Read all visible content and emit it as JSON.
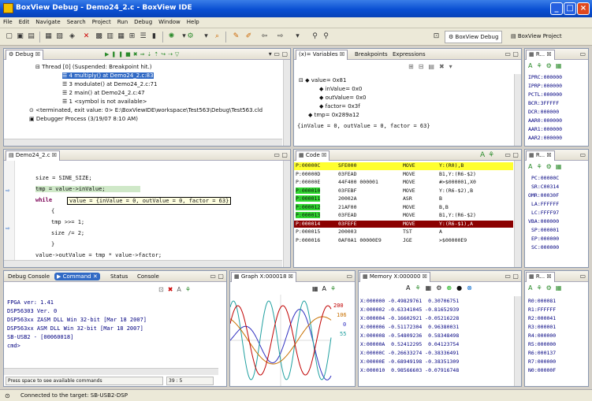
{
  "window": {
    "title": "BoxView Debug - Demo24_2.c - BoxView IDE",
    "min": "_",
    "max": "□",
    "close": "×"
  },
  "menu": [
    "File",
    "Edit",
    "Navigate",
    "Search",
    "Project",
    "Run",
    "Debug",
    "Window",
    "Help"
  ],
  "perspectives": {
    "debug": "BoxView Debug",
    "project": "BoxView Project"
  },
  "debug_view": {
    "tab": "Debug",
    "rows": [
      "Thread [0] (Suspended: Breakpoint hit.)",
      "4 multiply() at Demo24_2.c:83",
      "3 modulate() at Demo24_2.c:71",
      "2 main() at Demo24_2.c:47",
      "1 <symbol is not available>",
      "<terminated, exit value: 0> E:\\BoxViewIDE\\workspace\\Test563\\Debug\\Test563.cld",
      "Debugger Process (3/19/07 8:10 AM)"
    ]
  },
  "variables_view": {
    "tabs": [
      "Variables",
      "Breakpoints",
      "Expressions"
    ],
    "rows": [
      "value= 0x81",
      "inValue= 0x0",
      "outValue= 0x0",
      "factor= 0x3f",
      "tmp= 0x289a12"
    ],
    "detail": "{inValue = 0, outValue = 0, factor = 63}"
  },
  "reg_top": {
    "tab": "R...",
    "rows": [
      "IPRC:000000",
      "IPRP:000000",
      "PCTL:000000",
      "BCR:3FFFFF",
      "DCR:000000",
      "AAR0:000000",
      "AAR1:000000",
      "AAR2:000000"
    ]
  },
  "editor": {
    "tab": "Demo24_2.c",
    "lines": [
      "size = SINE_SIZE;",
      "tmp = value->inValue;",
      "while (value = {inValue = 0, outValue = 0, factor = 63}",
      "{",
      "tmp >>= 1;",
      "size /= 2;",
      "}",
      "value->outValue = tmp * value->factor;"
    ],
    "hover": "value = {inValue = 0, outValue = 0, factor = 63}"
  },
  "code_view": {
    "tab": "Code",
    "rows": [
      {
        "addr": "P:00000C",
        "op": "SFE000",
        "mn": "MOVE",
        "arg": "Y:(R0),B",
        "hl": "yellow"
      },
      {
        "addr": "P:00000D",
        "op": "03FEAD",
        "mn": "MOVE",
        "arg": "B1,Y:(R6-$2)",
        "hl": ""
      },
      {
        "addr": "P:00000E",
        "op": "44F400 000001",
        "mn": "MOVE",
        "arg": "#>$000001,X0",
        "hl": ""
      },
      {
        "addr": "P:000010",
        "op": "03FEBF",
        "mn": "MOVE",
        "arg": "Y:(R6-$2),B",
        "hl": "green"
      },
      {
        "addr": "P:000011",
        "op": "20002A",
        "mn": "ASR",
        "arg": "B",
        "hl": "green"
      },
      {
        "addr": "P:000012",
        "op": "21AF00",
        "mn": "MOVE",
        "arg": "B,B",
        "hl": "green"
      },
      {
        "addr": "P:000013",
        "op": "03FEAD",
        "mn": "MOVE",
        "arg": "B1,Y:(R6-$2)",
        "hl": "green"
      },
      {
        "addr": "P:000014",
        "op": "03FEFE",
        "mn": "MOVE",
        "arg": "Y:(R6-$1),A",
        "hl": "red"
      },
      {
        "addr": "P:000015",
        "op": "200003",
        "mn": "TST",
        "arg": "A",
        "hl": ""
      },
      {
        "addr": "P:000016",
        "op": "0AF0A1 00000E9",
        "mn": "JGE",
        "arg": ">$00000E9",
        "hl": ""
      }
    ]
  },
  "reg_mid": {
    "tab": "R...",
    "rows": [
      "PC:00000C",
      "SR:C00314",
      "OMR:00030F",
      "LA:FFFFFF",
      "LC:FFFF97",
      "VBA:000000",
      "SP:000001",
      "EP:000000",
      "SC:000000"
    ]
  },
  "console": {
    "tabs": [
      "Debug Console",
      "Command",
      "Status",
      "Console"
    ],
    "lines": [
      "FPGA ver: 1.41",
      "DSP56303 Ver. 0",
      "DSP563xx ZASM DLL Win 32-bit [Mar 18 2007]",
      "DSP563xx ASM DLL Win 32-bit [Mar 18 2007]",
      "SB-USB2 - [00060018]",
      "cmd>"
    ],
    "hint": "Press space to see available commands",
    "pos": "39 : 5"
  },
  "graph": {
    "tab": "Graph X:000018",
    "labels": [
      "200",
      "106",
      "0",
      "55"
    ],
    "colors": [
      "#c00000",
      "#c87000",
      "#3030c0",
      "#20a0a0"
    ]
  },
  "memory": {
    "tab": "Memory X:000000",
    "rows": [
      [
        "X:000000",
        "-0.49829761",
        "0.30706751"
      ],
      [
        "X:000002",
        "-0.63341045",
        "-0.81652939"
      ],
      [
        "X:000004",
        "-0.16602921",
        "-0.05216228"
      ],
      [
        "X:000006",
        "-0.51172304",
        "0.96380031"
      ],
      [
        "X:000008",
        "-0.54809236",
        "0.58348498"
      ],
      [
        "X:00000A",
        "0.52412295",
        "0.04123754"
      ],
      [
        "X:00000C",
        "-0.26633274",
        "-0.38336491"
      ],
      [
        "X:00000E",
        "-0.68949198",
        "-0.38351309"
      ],
      [
        "X:000010",
        "0.98566603",
        "-0.07916748"
      ]
    ]
  },
  "reg_bot": {
    "tab": "R...",
    "rows": [
      "R0:000081",
      "R1:FFFFFF",
      "R2:000041",
      "R3:000001",
      "R4:000000",
      "R5:000000",
      "R6:000137",
      "R7:000000",
      "N0:00000F"
    ]
  },
  "status": {
    "text": "Connected to the target: SB-USB2-DSP"
  }
}
